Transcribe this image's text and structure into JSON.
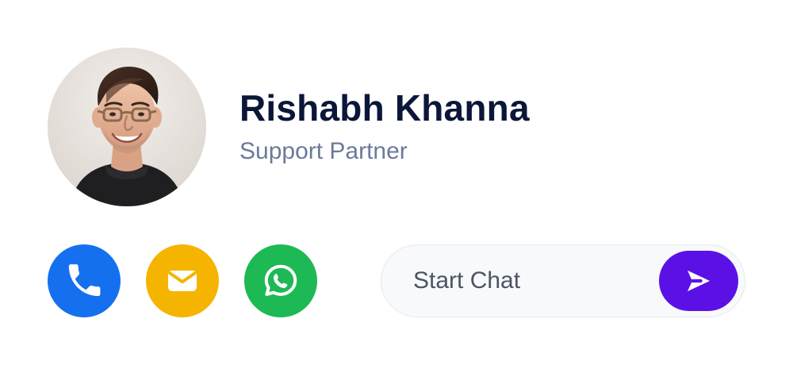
{
  "profile": {
    "name": "Rishabh Khanna",
    "role": "Support Partner",
    "avatar_icon": "person-avatar-photo"
  },
  "actions": {
    "call": {
      "icon": "phone-icon",
      "color": "#1570EF"
    },
    "email": {
      "icon": "mail-icon",
      "color": "#F5B400"
    },
    "whatsapp": {
      "icon": "whatsapp-icon",
      "color": "#1DB954"
    }
  },
  "chat": {
    "label": "Start Chat",
    "send_icon": "send-arrow-icon",
    "send_color": "#5B11E6"
  },
  "colors": {
    "name": "#0B1739",
    "role": "#6B7A99"
  }
}
